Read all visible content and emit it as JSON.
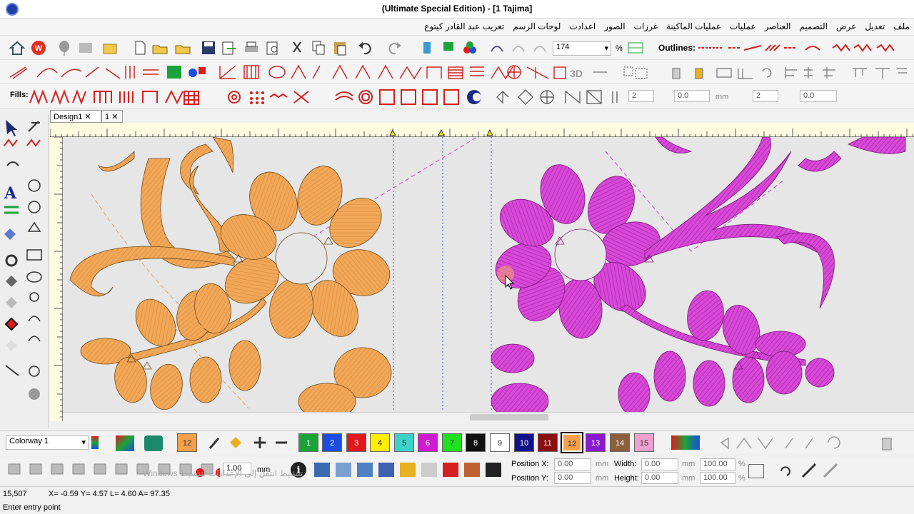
{
  "window": {
    "title": "(Ultimate Special Edition) - [1      Tajima]"
  },
  "menu": [
    "ملف",
    "تعديل",
    "عرض",
    "التصميم",
    "العناصر",
    "عمليات",
    "عمليات الماكينة",
    "غرزات",
    "الصور",
    "اعدادت",
    "لوحات الرسم",
    "تعريب عبد القادر كيتوع"
  ],
  "toolbar": {
    "zoom": "174",
    "zoom_unit": "%",
    "outlines_label": "Outlines:",
    "fills_label": "Fills:",
    "fill_value1": "2",
    "fill_value2": "0.0",
    "fill_unit": "mm",
    "fill_value3": "2",
    "fill_value4": "0.0"
  },
  "tabs": [
    {
      "label": "Design1"
    },
    {
      "label": "1"
    }
  ],
  "colorway": {
    "selected": "Colorway 1"
  },
  "palette": [
    {
      "num": "12",
      "color": "#f5a04a",
      "text": "#333"
    },
    {
      "num": "1",
      "color": "#1aa33a",
      "text": "#fff"
    },
    {
      "num": "2",
      "color": "#1a4de0",
      "text": "#fff"
    },
    {
      "num": "3",
      "color": "#e01a1a",
      "text": "#fff"
    },
    {
      "num": "4",
      "color": "#ffee00",
      "text": "#333"
    },
    {
      "num": "5",
      "color": "#3cd2c8",
      "text": "#333"
    },
    {
      "num": "6",
      "color": "#d01ad0",
      "text": "#fff"
    },
    {
      "num": "7",
      "color": "#20e020",
      "text": "#333"
    },
    {
      "num": "8",
      "color": "#111111",
      "text": "#fff"
    },
    {
      "num": "9",
      "color": "#ffffff",
      "text": "#333"
    },
    {
      "num": "10",
      "color": "#10128a",
      "text": "#fff"
    },
    {
      "num": "11",
      "color": "#8a0f12",
      "text": "#fff"
    },
    {
      "num": "12",
      "color": "#f5a04a",
      "text": "#333"
    },
    {
      "num": "13",
      "color": "#8a1ad0",
      "text": "#fff"
    },
    {
      "num": "14",
      "color": "#8b5e3c",
      "text": "#fff"
    },
    {
      "num": "15",
      "color": "#f0a0d0",
      "text": "#333"
    }
  ],
  "bottom": {
    "line_width": "1.00",
    "line_unit": "mm",
    "position_x_label": "Position X:",
    "position_y_label": "Position Y:",
    "position_x": "0.00",
    "position_y": "0.00",
    "mm": "mm",
    "width_label": "Width:",
    "height_label": "Height:",
    "width": "0.00",
    "height": "0.00",
    "width_pct": "100.00",
    "height_pct": "100.00",
    "pct": "%"
  },
  "status": {
    "stitches": "15,507",
    "coords": "X=  -0.59 Y=   4.57 L=  4.60 A= 97.35",
    "message": "Enter entry point",
    "watermark": "Windows تنشيط انتقل إلى الإعدادات لتنشيط"
  },
  "colors": {
    "orange": "#f5a04a",
    "magenta": "#d01ad0"
  }
}
